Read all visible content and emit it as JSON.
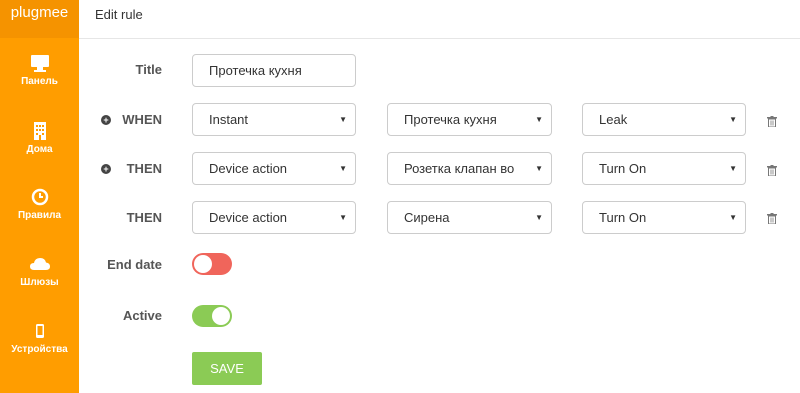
{
  "app": {
    "brand": "plugmee"
  },
  "sidebar": {
    "items": [
      {
        "label": "Панель",
        "icon": "monitor-icon"
      },
      {
        "label": "Дома",
        "icon": "building-icon"
      },
      {
        "label": "Правила",
        "icon": "clock-icon"
      },
      {
        "label": "Шлюзы",
        "icon": "cloud-icon"
      },
      {
        "label": "Устройства",
        "icon": "phone-icon"
      }
    ]
  },
  "header": {
    "title": "Edit rule"
  },
  "form": {
    "title_label": "Title",
    "title_value": "Протечка кухня",
    "rows": [
      {
        "label": "WHEN",
        "has_add": true,
        "s1": "Instant",
        "s2": "Протечка кухня",
        "s3": "Leak"
      },
      {
        "label": "THEN",
        "has_add": true,
        "s1": "Device action",
        "s2": "Розетка клапан во",
        "s3": "Turn On"
      },
      {
        "label": "THEN",
        "has_add": false,
        "s1": "Device action",
        "s2": "Сирена",
        "s3": "Turn On"
      }
    ],
    "end_date_label": "End date",
    "end_date_on": false,
    "active_label": "Active",
    "active_on": true,
    "save_label": "SAVE"
  },
  "colors": {
    "sidebar": "#ff9d00",
    "toggle_off": "#f0655b",
    "toggle_on": "#8bcb55",
    "save": "#8bcb55"
  }
}
